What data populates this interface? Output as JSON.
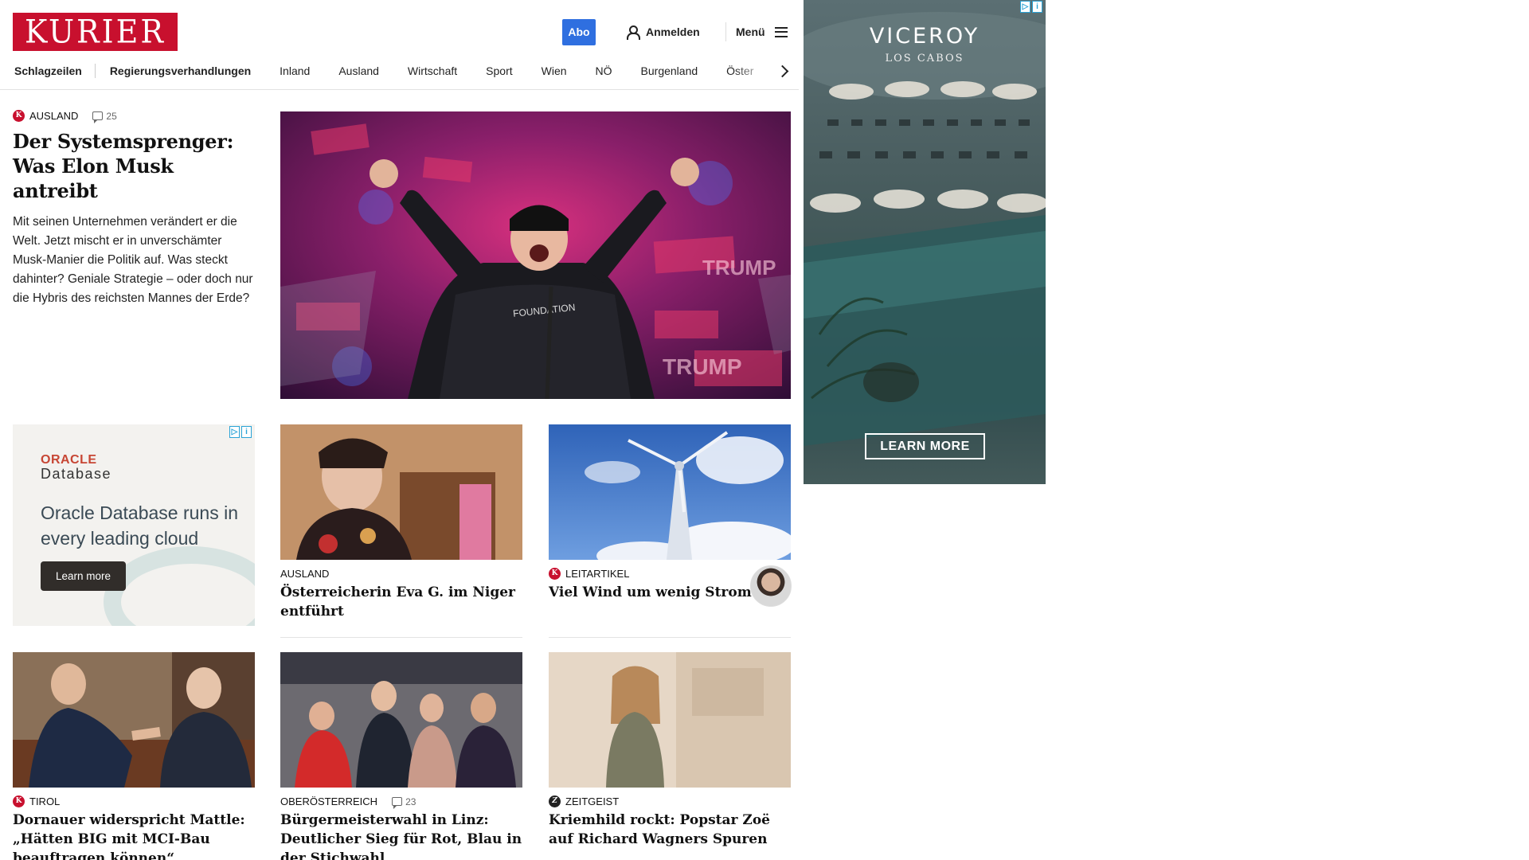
{
  "header": {
    "logo": "KURIER",
    "abo_label": "Abo",
    "login_label": "Anmelden",
    "menu_label": "Menü"
  },
  "nav": {
    "items": [
      "Schlagzeilen",
      "Regierungsverhandlungen",
      "Inland",
      "Ausland",
      "Wirtschaft",
      "Sport",
      "Wien",
      "NÖ",
      "Burgenland",
      "Öster"
    ]
  },
  "hero": {
    "kicker": "AUSLAND",
    "comments": "25",
    "title": "Der Systemsprenger: Was Elon Musk antreibt",
    "lead": "Mit seinen Unternehmen verändert er die Welt. Jetzt mischt er in unverschämter Musk-Manier die Politik auf. Was steckt dahinter? Geniale Strategie – oder doch nur die Hybris des reichsten Mannes der Erde?",
    "image_shirt_text": "FOUNDATION"
  },
  "ad_oracle": {
    "brand": "ORACLE",
    "sub": "Database",
    "text": "Oracle Database runs in every leading cloud",
    "button": "Learn more"
  },
  "ad_viceroy": {
    "brand": "VICEROY",
    "sub": "LOS CABOS",
    "button": "LEARN MORE"
  },
  "teasers": [
    {
      "kicker": "AUSLAND",
      "title": "Österreicherin Eva G. im Niger entführt",
      "badge": ""
    },
    {
      "kicker": "LEITARTIKEL",
      "title": "Viel Wind um wenig Strom",
      "badge": "K"
    },
    {
      "kicker": "TIROL",
      "title": "Dornauer widerspricht Mattle: „Hätten BIG mit MCI-Bau beauftra­gen können“",
      "badge": "K"
    },
    {
      "kicker": "OBERÖSTERREICH",
      "comments": "23",
      "title": "Bürgermeisterwahl in Linz: Deutli­cher Sieg für Rot, Blau in der Stichwahl",
      "badge": ""
    },
    {
      "kicker": "ZEITGEIST",
      "title": "Kriemhild rockt: Popstar Zoë auf Richard Wagners Spuren",
      "badge": "Z"
    }
  ],
  "colors": {
    "brand_red": "#c8102e",
    "abo_blue": "#2f6fe0",
    "text": "#111111"
  }
}
